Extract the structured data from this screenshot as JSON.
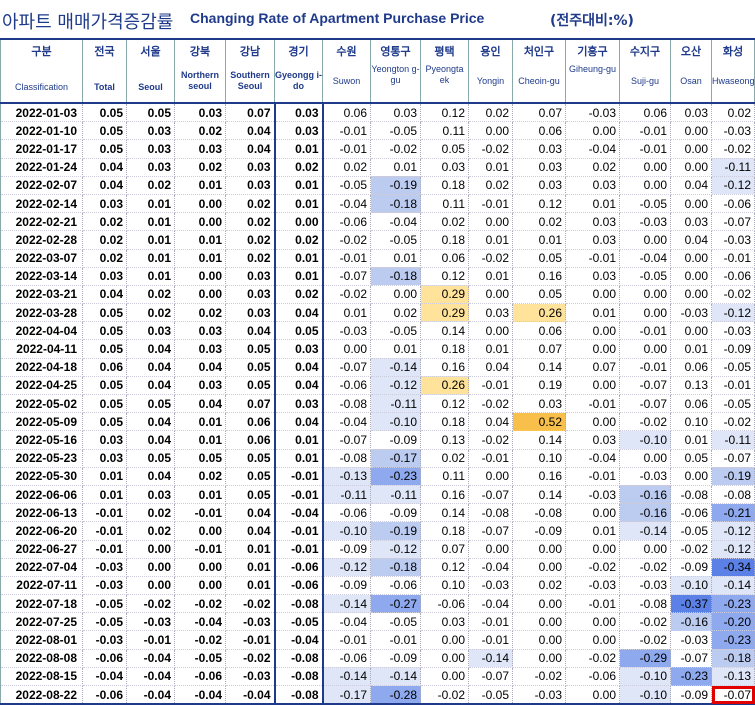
{
  "header": {
    "title_ko": "아파트 매매가격증감률",
    "title_en": "Changing Rate of Apartment Purchase Price",
    "unit": "(전주대비:%)"
  },
  "columns": [
    {
      "ko": "구분",
      "en": "Classification"
    },
    {
      "ko": "전국",
      "en": "Total"
    },
    {
      "ko": "서울",
      "en": "Seoul"
    },
    {
      "ko": "강북",
      "en": "Northern seoul"
    },
    {
      "ko": "강남",
      "en": "Southern Seoul"
    },
    {
      "ko": "경기",
      "en": "Gyeongg i-do"
    },
    {
      "ko": "수원",
      "en": "Suwon"
    },
    {
      "ko": "영통구",
      "en": "Yeongton g-gu"
    },
    {
      "ko": "평택",
      "en": "Pyeongta ek"
    },
    {
      "ko": "용인",
      "en": "Yongin"
    },
    {
      "ko": "처인구",
      "en": "Cheoin-gu"
    },
    {
      "ko": "기흥구",
      "en": "Giheung-gu"
    },
    {
      "ko": "수지구",
      "en": "Suji-gu"
    },
    {
      "ko": "오산",
      "en": "Osan"
    },
    {
      "ko": "화성",
      "en": "Hwaseong"
    }
  ],
  "highlight_colors": {
    "neg_light": "#dfe6f7",
    "neg_mid": "#bccbf0",
    "neg_strong": "#8ea9ee",
    "neg_max": "#5b80e6",
    "pos_light": "#ffe39a",
    "pos_strong": "#f8c04a",
    "outline": "#e00000",
    "text_blue": "#1f3a8a"
  },
  "rows": [
    [
      "2022-01-03",
      "0.05",
      "0.05",
      "0.03",
      "0.07",
      "0.03",
      "0.06",
      "0.03",
      "0.12",
      "0.02",
      "0.07",
      "-0.03",
      "0.06",
      "0.03",
      "0.02"
    ],
    [
      "2022-01-10",
      "0.05",
      "0.03",
      "0.02",
      "0.04",
      "0.03",
      "-0.01",
      "-0.05",
      "0.11",
      "0.00",
      "0.06",
      "0.00",
      "-0.01",
      "0.00",
      "-0.03"
    ],
    [
      "2022-01-17",
      "0.05",
      "0.03",
      "0.03",
      "0.04",
      "0.01",
      "-0.01",
      "-0.02",
      "0.05",
      "-0.02",
      "0.03",
      "-0.04",
      "-0.01",
      "0.00",
      "-0.02"
    ],
    [
      "2022-01-24",
      "0.04",
      "0.03",
      "0.02",
      "0.03",
      "0.02",
      "0.02",
      "0.01",
      "0.03",
      "0.01",
      "0.03",
      "0.02",
      "0.00",
      "0.00",
      "-0.11"
    ],
    [
      "2022-02-07",
      "0.04",
      "0.02",
      "0.01",
      "0.03",
      "0.01",
      "-0.05",
      "-0.19",
      "0.18",
      "0.02",
      "0.03",
      "0.03",
      "0.00",
      "0.04",
      "-0.12"
    ],
    [
      "2022-02-14",
      "0.03",
      "0.01",
      "0.00",
      "0.02",
      "0.01",
      "-0.04",
      "-0.18",
      "0.11",
      "-0.01",
      "0.12",
      "0.01",
      "-0.05",
      "0.00",
      "-0.06"
    ],
    [
      "2022-02-21",
      "0.02",
      "0.01",
      "0.00",
      "0.02",
      "0.00",
      "-0.06",
      "-0.04",
      "0.02",
      "0.00",
      "0.02",
      "0.03",
      "-0.03",
      "0.03",
      "-0.07"
    ],
    [
      "2022-02-28",
      "0.02",
      "0.01",
      "0.01",
      "0.02",
      "0.02",
      "-0.02",
      "-0.05",
      "0.18",
      "0.01",
      "0.01",
      "0.03",
      "0.00",
      "0.04",
      "-0.03"
    ],
    [
      "2022-03-07",
      "0.02",
      "0.01",
      "0.01",
      "0.02",
      "0.01",
      "-0.01",
      "0.01",
      "0.06",
      "-0.02",
      "0.05",
      "-0.01",
      "-0.04",
      "0.00",
      "-0.01"
    ],
    [
      "2022-03-14",
      "0.03",
      "0.01",
      "0.00",
      "0.03",
      "0.01",
      "-0.07",
      "-0.18",
      "0.12",
      "0.01",
      "0.16",
      "0.03",
      "-0.05",
      "0.00",
      "-0.06"
    ],
    [
      "2022-03-21",
      "0.04",
      "0.02",
      "0.00",
      "0.03",
      "0.02",
      "-0.02",
      "0.00",
      "0.29",
      "0.00",
      "0.05",
      "0.00",
      "0.00",
      "0.00",
      "-0.02"
    ],
    [
      "2022-03-28",
      "0.05",
      "0.02",
      "0.02",
      "0.03",
      "0.04",
      "0.01",
      "0.02",
      "0.29",
      "0.03",
      "0.26",
      "0.01",
      "0.00",
      "-0.03",
      "-0.12"
    ],
    [
      "2022-04-04",
      "0.05",
      "0.03",
      "0.03",
      "0.04",
      "0.05",
      "-0.03",
      "-0.05",
      "0.14",
      "0.00",
      "0.06",
      "0.00",
      "-0.01",
      "0.00",
      "-0.03"
    ],
    [
      "2022-04-11",
      "0.05",
      "0.04",
      "0.03",
      "0.05",
      "0.03",
      "0.00",
      "0.01",
      "0.18",
      "0.01",
      "0.07",
      "0.00",
      "0.00",
      "0.01",
      "-0.09"
    ],
    [
      "2022-04-18",
      "0.06",
      "0.04",
      "0.04",
      "0.05",
      "0.04",
      "-0.07",
      "-0.14",
      "0.16",
      "0.04",
      "0.14",
      "0.07",
      "-0.01",
      "0.06",
      "-0.05"
    ],
    [
      "2022-04-25",
      "0.05",
      "0.04",
      "0.03",
      "0.05",
      "0.04",
      "-0.06",
      "-0.12",
      "0.26",
      "-0.01",
      "0.19",
      "0.00",
      "-0.07",
      "0.13",
      "-0.01"
    ],
    [
      "2022-05-02",
      "0.05",
      "0.05",
      "0.04",
      "0.07",
      "0.03",
      "-0.08",
      "-0.11",
      "0.12",
      "-0.02",
      "0.03",
      "-0.01",
      "-0.07",
      "0.06",
      "-0.05"
    ],
    [
      "2022-05-09",
      "0.05",
      "0.04",
      "0.01",
      "0.06",
      "0.04",
      "-0.04",
      "-0.10",
      "0.18",
      "0.04",
      "0.52",
      "0.00",
      "-0.02",
      "0.10",
      "-0.02"
    ],
    [
      "2022-05-16",
      "0.03",
      "0.04",
      "0.01",
      "0.06",
      "0.01",
      "-0.07",
      "-0.09",
      "0.13",
      "-0.02",
      "0.14",
      "0.03",
      "-0.10",
      "0.01",
      "-0.11"
    ],
    [
      "2022-05-23",
      "0.03",
      "0.05",
      "0.05",
      "0.05",
      "0.01",
      "-0.08",
      "-0.17",
      "0.02",
      "-0.01",
      "0.10",
      "-0.04",
      "0.00",
      "0.05",
      "-0.07"
    ],
    [
      "2022-05-30",
      "0.01",
      "0.04",
      "0.02",
      "0.05",
      "-0.01",
      "-0.13",
      "-0.23",
      "0.11",
      "0.00",
      "0.16",
      "-0.01",
      "-0.03",
      "0.00",
      "-0.19"
    ],
    [
      "2022-06-06",
      "0.01",
      "0.03",
      "0.01",
      "0.05",
      "-0.01",
      "-0.11",
      "-0.11",
      "0.16",
      "-0.07",
      "0.14",
      "-0.03",
      "-0.16",
      "-0.08",
      "-0.08"
    ],
    [
      "2022-06-13",
      "-0.01",
      "0.02",
      "-0.01",
      "0.04",
      "-0.04",
      "-0.06",
      "-0.09",
      "0.14",
      "-0.08",
      "-0.08",
      "0.00",
      "-0.16",
      "-0.06",
      "-0.21"
    ],
    [
      "2022-06-20",
      "-0.01",
      "0.02",
      "0.00",
      "0.04",
      "-0.01",
      "-0.10",
      "-0.19",
      "0.18",
      "-0.07",
      "-0.09",
      "0.01",
      "-0.14",
      "-0.05",
      "-0.12"
    ],
    [
      "2022-06-27",
      "-0.01",
      "0.00",
      "-0.01",
      "0.01",
      "-0.01",
      "-0.09",
      "-0.12",
      "0.07",
      "0.00",
      "0.00",
      "0.00",
      "0.00",
      "-0.02",
      "-0.12"
    ],
    [
      "2022-07-04",
      "-0.03",
      "0.00",
      "0.00",
      "0.01",
      "-0.06",
      "-0.12",
      "-0.18",
      "0.12",
      "-0.04",
      "0.00",
      "-0.02",
      "-0.02",
      "-0.09",
      "-0.34"
    ],
    [
      "2022-07-11",
      "-0.03",
      "0.00",
      "0.00",
      "0.01",
      "-0.06",
      "-0.09",
      "-0.06",
      "0.10",
      "-0.03",
      "0.02",
      "-0.03",
      "-0.03",
      "-0.10",
      "-0.14"
    ],
    [
      "2022-07-18",
      "-0.05",
      "-0.02",
      "-0.02",
      "-0.02",
      "-0.08",
      "-0.14",
      "-0.27",
      "-0.06",
      "-0.04",
      "0.00",
      "-0.01",
      "-0.08",
      "-0.37",
      "-0.23"
    ],
    [
      "2022-07-25",
      "-0.05",
      "-0.03",
      "-0.04",
      "-0.03",
      "-0.05",
      "-0.04",
      "-0.05",
      "0.03",
      "-0.01",
      "0.00",
      "0.00",
      "-0.02",
      "-0.16",
      "-0.20"
    ],
    [
      "2022-08-01",
      "-0.03",
      "-0.01",
      "-0.02",
      "-0.01",
      "-0.04",
      "-0.01",
      "-0.01",
      "0.00",
      "-0.01",
      "0.00",
      "0.00",
      "-0.02",
      "-0.03",
      "-0.23"
    ],
    [
      "2022-08-08",
      "-0.06",
      "-0.04",
      "-0.05",
      "-0.02",
      "-0.08",
      "-0.06",
      "-0.09",
      "0.00",
      "-0.14",
      "0.00",
      "-0.02",
      "-0.29",
      "-0.07",
      "-0.18"
    ],
    [
      "2022-08-15",
      "-0.04",
      "-0.04",
      "-0.06",
      "-0.03",
      "-0.08",
      "-0.14",
      "-0.14",
      "0.00",
      "-0.07",
      "-0.02",
      "-0.06",
      "-0.10",
      "-0.23",
      "-0.13"
    ],
    [
      "2022-08-22",
      "-0.06",
      "-0.04",
      "-0.04",
      "-0.04",
      "-0.08",
      "-0.17",
      "-0.28",
      "-0.02",
      "-0.05",
      "-0.03",
      "0.00",
      "-0.10",
      "-0.09",
      "-0.07"
    ]
  ]
}
